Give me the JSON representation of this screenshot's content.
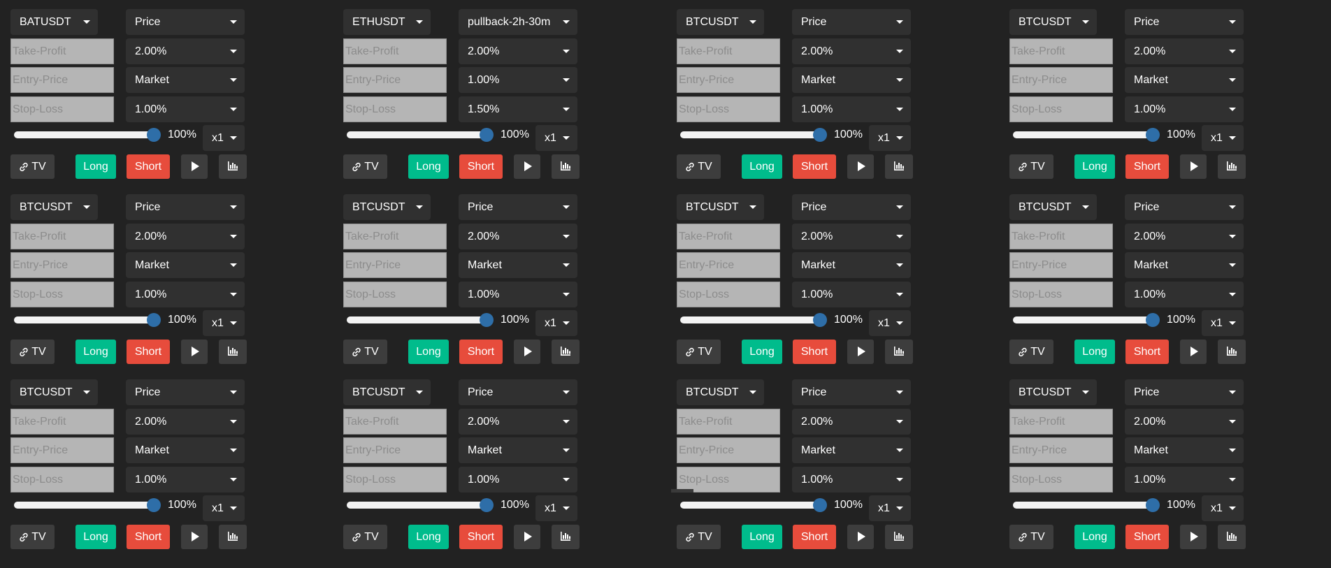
{
  "panels": [
    {
      "symbol": "BATUSDT",
      "mode": "Price",
      "tp_placeholder": "Take-Profit",
      "tp_value": "2.00%",
      "ep_placeholder": "Entry-Price",
      "ep_value": "Market",
      "sl_placeholder": "Stop-Loss",
      "sl_value": "1.00%",
      "size_percent": "100%",
      "size_value": 100,
      "leverage": "x1",
      "tv_label": "TV",
      "long_label": "Long",
      "short_label": "Short"
    },
    {
      "symbol": "ETHUSDT",
      "mode": "pullback-2h-30m",
      "tp_placeholder": "Take-Profit",
      "tp_value": "2.00%",
      "ep_placeholder": "Entry-Price",
      "ep_value": "1.00%",
      "sl_placeholder": "Stop-Loss",
      "sl_value": "1.50%",
      "size_percent": "100%",
      "size_value": 100,
      "leverage": "x1",
      "tv_label": "TV",
      "long_label": "Long",
      "short_label": "Short"
    },
    {
      "symbol": "BTCUSDT",
      "mode": "Price",
      "tp_placeholder": "Take-Profit",
      "tp_value": "2.00%",
      "ep_placeholder": "Entry-Price",
      "ep_value": "Market",
      "sl_placeholder": "Stop-Loss",
      "sl_value": "1.00%",
      "size_percent": "100%",
      "size_value": 100,
      "leverage": "x1",
      "tv_label": "TV",
      "long_label": "Long",
      "short_label": "Short"
    },
    {
      "symbol": "BTCUSDT",
      "mode": "Price",
      "tp_placeholder": "Take-Profit",
      "tp_value": "2.00%",
      "ep_placeholder": "Entry-Price",
      "ep_value": "Market",
      "sl_placeholder": "Stop-Loss",
      "sl_value": "1.00%",
      "size_percent": "100%",
      "size_value": 100,
      "leverage": "x1",
      "tv_label": "TV",
      "long_label": "Long",
      "short_label": "Short"
    },
    {
      "symbol": "BTCUSDT",
      "mode": "Price",
      "tp_placeholder": "Take-Profit",
      "tp_value": "2.00%",
      "ep_placeholder": "Entry-Price",
      "ep_value": "Market",
      "sl_placeholder": "Stop-Loss",
      "sl_value": "1.00%",
      "size_percent": "100%",
      "size_value": 100,
      "leverage": "x1",
      "tv_label": "TV",
      "long_label": "Long",
      "short_label": "Short"
    },
    {
      "symbol": "BTCUSDT",
      "mode": "Price",
      "tp_placeholder": "Take-Profit",
      "tp_value": "2.00%",
      "ep_placeholder": "Entry-Price",
      "ep_value": "Market",
      "sl_placeholder": "Stop-Loss",
      "sl_value": "1.00%",
      "size_percent": "100%",
      "size_value": 100,
      "leverage": "x1",
      "tv_label": "TV",
      "long_label": "Long",
      "short_label": "Short"
    },
    {
      "symbol": "BTCUSDT",
      "mode": "Price",
      "tp_placeholder": "Take-Profit",
      "tp_value": "2.00%",
      "ep_placeholder": "Entry-Price",
      "ep_value": "Market",
      "sl_placeholder": "Stop-Loss",
      "sl_value": "1.00%",
      "size_percent": "100%",
      "size_value": 100,
      "leverage": "x1",
      "tv_label": "TV",
      "long_label": "Long",
      "short_label": "Short"
    },
    {
      "symbol": "BTCUSDT",
      "mode": "Price",
      "tp_placeholder": "Take-Profit",
      "tp_value": "2.00%",
      "ep_placeholder": "Entry-Price",
      "ep_value": "Market",
      "sl_placeholder": "Stop-Loss",
      "sl_value": "1.00%",
      "size_percent": "100%",
      "size_value": 100,
      "leverage": "x1",
      "tv_label": "TV",
      "long_label": "Long",
      "short_label": "Short"
    },
    {
      "symbol": "BTCUSDT",
      "mode": "Price",
      "tp_placeholder": "Take-Profit",
      "tp_value": "2.00%",
      "ep_placeholder": "Entry-Price",
      "ep_value": "Market",
      "sl_placeholder": "Stop-Loss",
      "sl_value": "1.00%",
      "size_percent": "100%",
      "size_value": 100,
      "leverage": "x1",
      "tv_label": "TV",
      "long_label": "Long",
      "short_label": "Short"
    },
    {
      "symbol": "BTCUSDT",
      "mode": "Price",
      "tp_placeholder": "Take-Profit",
      "tp_value": "2.00%",
      "ep_placeholder": "Entry-Price",
      "ep_value": "Market",
      "sl_placeholder": "Stop-Loss",
      "sl_value": "1.00%",
      "size_percent": "100%",
      "size_value": 100,
      "leverage": "x1",
      "tv_label": "TV",
      "long_label": "Long",
      "short_label": "Short"
    },
    {
      "symbol": "BTCUSDT",
      "mode": "Price",
      "tp_placeholder": "Take-Profit",
      "tp_value": "2.00%",
      "ep_placeholder": "Entry-Price",
      "ep_value": "Market",
      "sl_placeholder": "Stop-Loss",
      "sl_value": "1.00%",
      "size_percent": "100%",
      "size_value": 100,
      "leverage": "x1",
      "tv_label": "TV",
      "long_label": "Long",
      "short_label": "Short"
    },
    {
      "symbol": "BTCUSDT",
      "mode": "Price",
      "tp_placeholder": "Take-Profit",
      "tp_value": "2.00%",
      "ep_placeholder": "Entry-Price",
      "ep_value": "Market",
      "sl_placeholder": "Stop-Loss",
      "sl_value": "1.00%",
      "size_percent": "100%",
      "size_value": 100,
      "leverage": "x1",
      "tv_label": "TV",
      "long_label": "Long",
      "short_label": "Short"
    }
  ],
  "colors": {
    "background": "#222222",
    "select_bg": "#303030",
    "input_bg": "#b5b5b5",
    "long": "#00bc8c",
    "short": "#e74c3c",
    "slider_thumb": "#2e6ea8",
    "icon_button": "#3d3d3d"
  },
  "icons": {
    "tv_button": "link-icon",
    "play_button": "play-icon",
    "chart_button": "bar-chart-icon",
    "select_caret": "caret-down-icon"
  }
}
